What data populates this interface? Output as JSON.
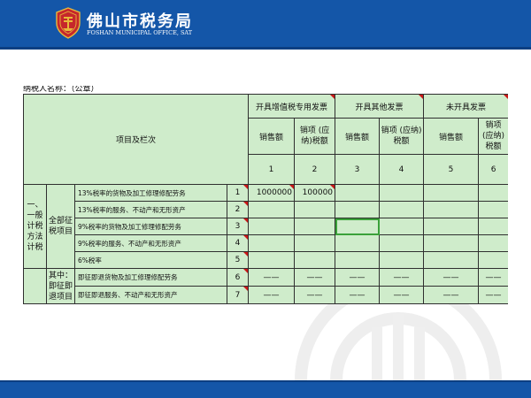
{
  "header": {
    "org_name_cn": "佛山市税务局",
    "org_name_en": "FOSHAN MUNICIPAL OFFICE, SAT",
    "emblem_icon": "tax-emblem-icon",
    "background_color": "#1456a8"
  },
  "form": {
    "taxpayer_label": "纳税人名称：（公章）",
    "header_item": "项目及栏次",
    "groups": [
      "开具增值税专用发票",
      "开具其他发票",
      "未开具发票"
    ],
    "col_labels": [
      "销售额",
      "销项 (应纳)税额",
      "销售额",
      "销项 (应纳)税额",
      "销售额",
      "销项 (应纳)税额"
    ],
    "col_numbers": [
      "1",
      "2",
      "3",
      "4",
      "5",
      "6"
    ],
    "section_label": "一、一般计税方法计税",
    "sub_all": "全部征税项目",
    "sub_immediate": "其中：即征即退项目",
    "rows": [
      {
        "label": "13%税率的货物及加工修理修配劳务",
        "num": "1",
        "values": [
          "1000000",
          "100000",
          "",
          "",
          "",
          ""
        ]
      },
      {
        "label": "13%税率的服务、不动产和无形资产",
        "num": "2",
        "values": [
          "",
          "",
          "",
          "",
          "",
          ""
        ]
      },
      {
        "label": "9%税率的货物及加工修理修配劳务",
        "num": "3",
        "values": [
          "",
          "",
          "",
          "",
          "",
          ""
        ]
      },
      {
        "label": "9%税率的服务、不动产和无形资产",
        "num": "4",
        "values": [
          "",
          "",
          "",
          "",
          "",
          ""
        ]
      },
      {
        "label": "6%税率",
        "num": "5",
        "values": [
          "",
          "",
          "",
          "",
          "",
          ""
        ]
      },
      {
        "label": "即征即退货物及加工修理修配劳务",
        "num": "6",
        "values": [
          "——",
          "——",
          "——",
          "——",
          "——",
          "——"
        ]
      },
      {
        "label": "即征即退服务、不动产和无形资产",
        "num": "7",
        "values": [
          "——",
          "——",
          "——",
          "——",
          "——",
          "——"
        ]
      }
    ],
    "selected_cell": {
      "row": 3,
      "col": 3
    },
    "cell_color": "#cfeccb",
    "selection_color": "#3aa13a",
    "marker_color": "#c91818"
  },
  "footer": {
    "background_color": "#1456a8"
  }
}
